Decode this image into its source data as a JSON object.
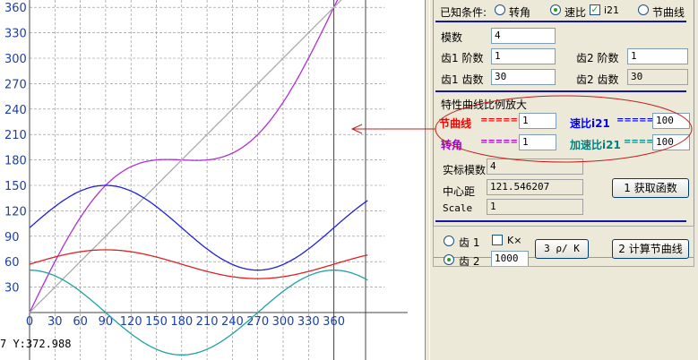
{
  "plot": {
    "y_ticks": [
      "360",
      "330",
      "300",
      "270",
      "240",
      "210",
      "180",
      "150",
      "120",
      "90",
      "60",
      "30"
    ],
    "x_ticks": [
      "0",
      "30",
      "60",
      "90",
      "120",
      "150",
      "180",
      "210",
      "240",
      "270",
      "300",
      "330",
      "360"
    ],
    "coord_readout": "7  Y:372.988",
    "colors": {
      "purple": "#b030d8",
      "gray": "#aaaaaa",
      "blue": "#2020e0",
      "red": "#e02020",
      "teal": "#20a0a0",
      "grid": "#888888",
      "axis": "#444444"
    }
  },
  "chart_data": {
    "type": "line",
    "xlim": [
      0,
      420
    ],
    "ylim": [
      -60,
      370
    ],
    "x_ticks": [
      0,
      30,
      60,
      90,
      120,
      150,
      180,
      210,
      240,
      270,
      300,
      330,
      360
    ],
    "y_ticks": [
      30,
      60,
      90,
      120,
      150,
      180,
      210,
      240,
      270,
      300,
      330,
      360
    ],
    "grid": true,
    "series": [
      {
        "color": "#b030d8",
        "kind": "sine_add",
        "params": [
          0,
          1,
          60
        ]
      },
      {
        "color": "#aaaaaa",
        "kind": "linear",
        "params": [
          0,
          1,
          0
        ]
      },
      {
        "color": "#2020e0",
        "kind": "sine",
        "params": [
          100,
          50,
          0
        ]
      },
      {
        "color": "#e02020",
        "kind": "sine",
        "params": [
          57,
          17,
          0
        ]
      },
      {
        "color": "#20a0a0",
        "kind": "cos2",
        "params": [
          0,
          50,
          0
        ]
      }
    ]
  },
  "panel": {
    "known_label": "已知条件:",
    "opt_angle": "转角",
    "opt_ratio": "速比",
    "chk_i21": "i21",
    "opt_pitch": "节曲线",
    "module_label": "模数",
    "module_value": "4",
    "g1_order_label": "齿1 阶数",
    "g1_order_value": "1",
    "g2_order_label": "齿2 阶数",
    "g2_order_value": "1",
    "g1_teeth_label": "齿1 齿数",
    "g1_teeth_value": "30",
    "g2_teeth_label": "齿2 齿数",
    "g2_teeth_value": "30",
    "scale_title": "特性曲线比例放大",
    "pitch_label": "节曲线",
    "pitch_eq": "======",
    "pitch_value": "1",
    "ratio_label": "速比i21",
    "ratio_eq": "======",
    "ratio_value": "100",
    "angle_label": "转角",
    "angle_eq": "======",
    "angle_value": "1",
    "accel_label": "加速比i21",
    "accel_eq": "====",
    "accel_value": "100",
    "actual_module_label": "实标模数",
    "actual_module_value": "4",
    "center_label": "中心距",
    "center_value": "121.546207",
    "scale_label": "Scale",
    "scale_value": "1",
    "get_func_btn": "1 获取函数",
    "gear1_radio": "齿 1",
    "kx_label": "K×",
    "gear2_radio": "齿 2",
    "gear2_value": "1000",
    "rho_btn": "3 ρ/ K",
    "calc_btn": "2 计算节曲线"
  }
}
